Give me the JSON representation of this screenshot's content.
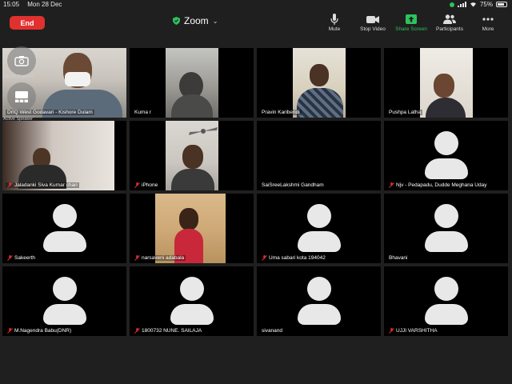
{
  "status_bar": {
    "time": "15:05",
    "date": "Mon 28 Dec",
    "battery": "75%"
  },
  "header": {
    "end_label": "End",
    "app_title": "Zoom"
  },
  "toolbar": [
    {
      "label": "Mute",
      "icon": "mic-icon"
    },
    {
      "label": "Stop Video",
      "icon": "video-camera-icon"
    },
    {
      "label": "Share Screen",
      "icon": "share-screen-icon"
    },
    {
      "label": "Participants",
      "icon": "participants-icon"
    },
    {
      "label": "More",
      "icon": "more-dots-icon"
    }
  ],
  "overlay": {
    "switch_camera": "Switch Camera",
    "active_speaker": "Active Speaker"
  },
  "participants": [
    {
      "name": "DrIQ West Godavari - Kishore Dulam",
      "muted": false,
      "video": true
    },
    {
      "name": "Kuma r",
      "muted": false,
      "video": true
    },
    {
      "name": "Pravin Kariberidi",
      "muted": false,
      "video": true
    },
    {
      "name": "Pushpa Latha",
      "muted": false,
      "video": true
    },
    {
      "name": "Jaladanki Siva Kumar chari",
      "muted": true,
      "video": true
    },
    {
      "name": "iPhone",
      "muted": true,
      "video": true
    },
    {
      "name": "SaiSreeLakshmi Gandham",
      "muted": false,
      "video": false
    },
    {
      "name": "Njv - Pedapadu, Dudde Meghana Uday",
      "muted": true,
      "video": false
    },
    {
      "name": "Sakeerth",
      "muted": true,
      "video": false
    },
    {
      "name": "narsaveni adabala",
      "muted": true,
      "video": true
    },
    {
      "name": "Uma sabari kota 194042",
      "muted": true,
      "video": false
    },
    {
      "name": "Bhavani",
      "muted": false,
      "video": false
    },
    {
      "name": "M.Nagendra Babu(DNR)",
      "muted": true,
      "video": false
    },
    {
      "name": "1800732 NUNE. SAILAJA",
      "muted": true,
      "video": false
    },
    {
      "name": "sivanand",
      "muted": false,
      "video": false
    },
    {
      "name": "UJJI VARSHITHA",
      "muted": true,
      "video": false
    }
  ],
  "colors": {
    "end": "#e0312f",
    "share": "#2ec25d",
    "active_border": "#3bd163",
    "mic_off": "#e0312f"
  }
}
